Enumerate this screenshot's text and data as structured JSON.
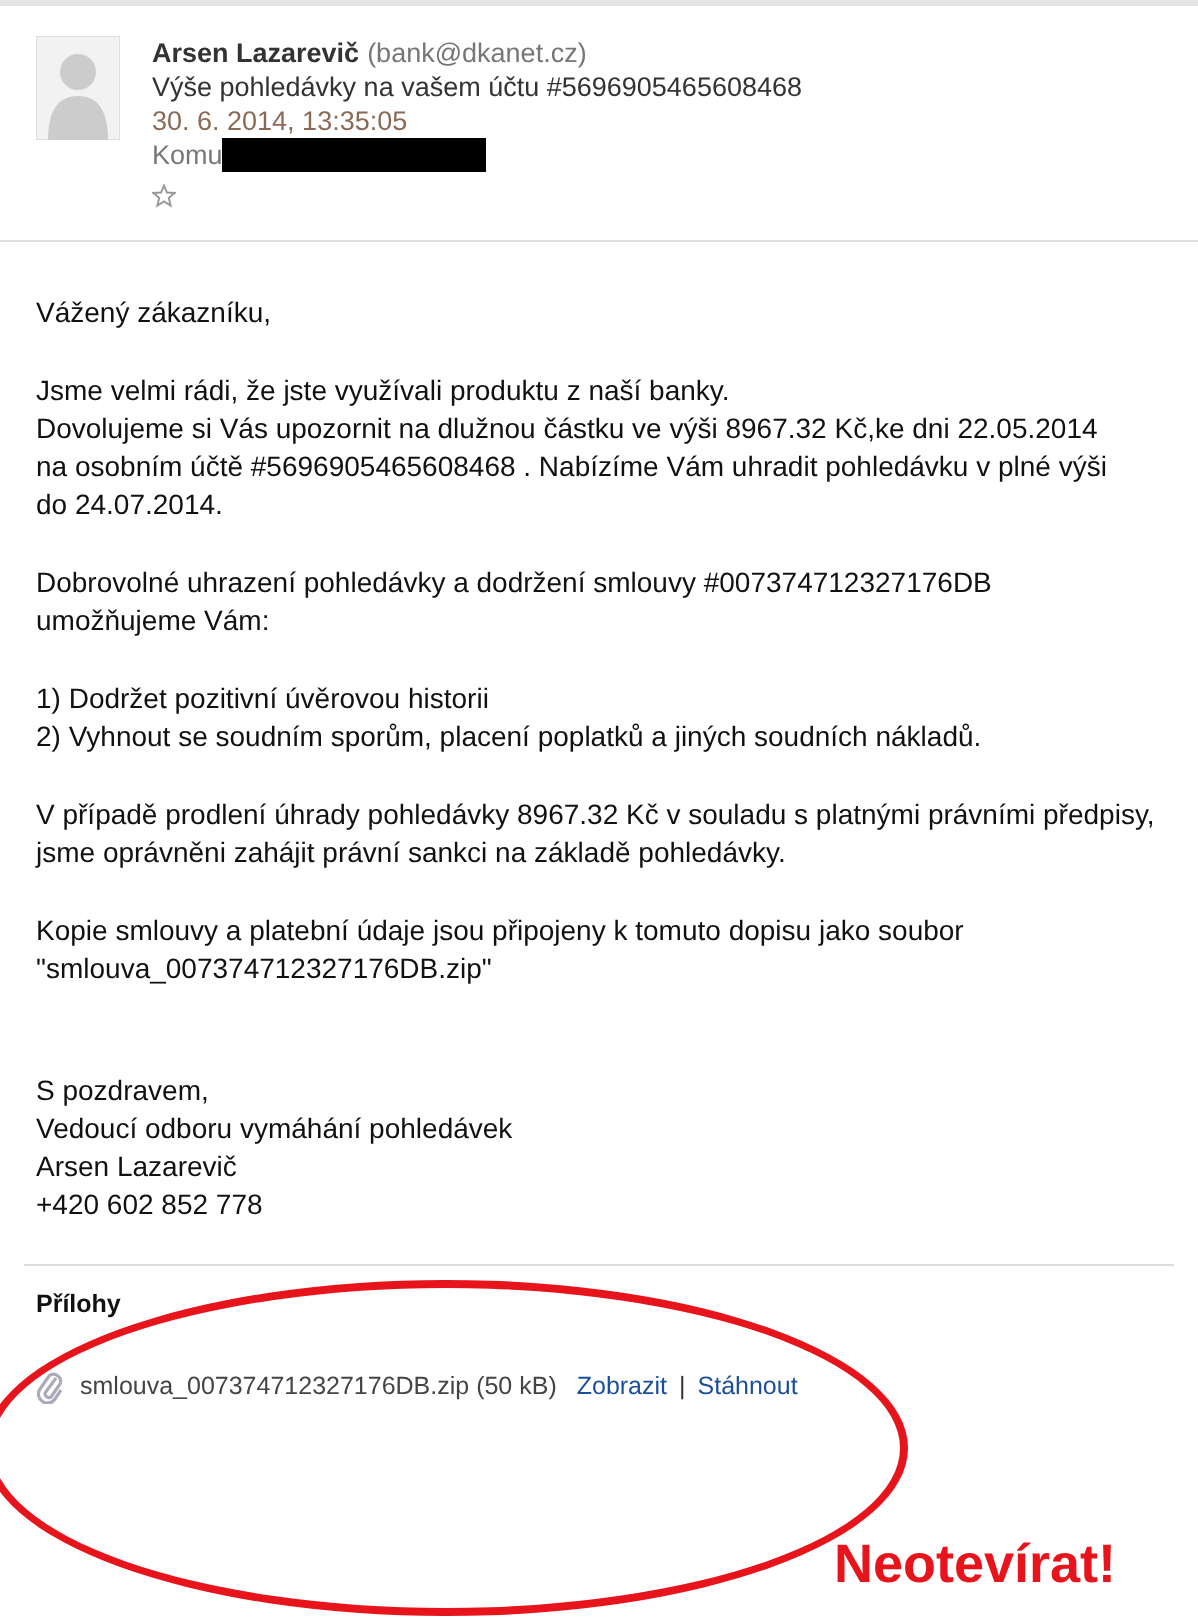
{
  "message": {
    "sender_name": "Arsen Lazarevič",
    "sender_email": "(bank@dkanet.cz)",
    "subject": "Výše pohledávky na vašem účtu #5696905465608468",
    "date": "30. 6. 2014, 13:35:05",
    "to_label": "Komu",
    "starred": false
  },
  "body": [
    {
      "lines": [
        "Vážený zákazníku,"
      ]
    },
    {
      "lines": [
        "Jsme velmi rádi, že jste využívali produktu z naší banky.",
        "Dovolujeme si Vás upozornit na dlužnou částku ve výši 8967.32 Kč,ke dni 22.05.2014",
        "na osobním účtě #5696905465608468 . Nabízíme Vám uhradit pohledávku v plné výši",
        "do 24.07.2014."
      ]
    },
    {
      "lines": [
        "Dobrovolné uhrazení pohledávky a dodržení smlouvy #007374712327176DB",
        "umožňujeme Vám:"
      ]
    },
    {
      "lines": [
        "1) Dodržet pozitivní úvěrovou historii",
        "2) Vyhnout se soudním sporům, placení poplatků a jiných soudních nákladů."
      ]
    },
    {
      "lines": [
        "V případě prodlení úhrady pohledávky 8967.32 Kč v souladu s platnými právními předpisy,",
        "jsme oprávněni zahájit právní sankci na základě pohledávky."
      ]
    },
    {
      "lines": [
        "Kopie smlouvy a platební údaje jsou připojeny k tomuto dopisu jako soubor",
        "\"smlouva_007374712327176DB.zip\""
      ]
    },
    {
      "lines": [
        "S pozdravem,",
        "Vedoucí odboru vymáhání pohledávek",
        "Arsen Lazarevič",
        "+420 602 852 778"
      ]
    }
  ],
  "attachments": {
    "title": "Přílohy",
    "items": [
      {
        "file": "smlouva_007374712327176DB.zip (50 kB)",
        "actions": [
          "Zobrazit",
          "Stáhnout"
        ],
        "separator": "|"
      }
    ]
  },
  "annotation": {
    "text": "Neotevírat!"
  }
}
